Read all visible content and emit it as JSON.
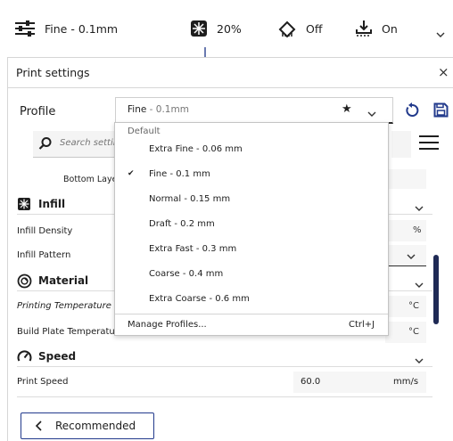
{
  "toolbar": {
    "profile_label": "Fine - 0.1mm",
    "infill_label": "20%",
    "support_label": "Off",
    "adhesion_label": "On"
  },
  "panel": {
    "title": "Print settings",
    "close_label": "×",
    "profile_label": "Profile",
    "selected_profile_name": "Fine",
    "selected_profile_suffix": " - 0.1mm",
    "search_placeholder": "Search settings"
  },
  "settings": {
    "bottom_layers_label": "Bottom Layers",
    "infill": {
      "title": "Infill",
      "density_label": "Infill Density",
      "density_unit": "%",
      "pattern_label": "Infill Pattern"
    },
    "material": {
      "title": "Material",
      "printing_temp_label": "Printing Temperature",
      "printing_temp_unit": "°C",
      "build_plate_temp_label": "Build Plate Temperature",
      "build_plate_temp_unit": "°C"
    },
    "speed": {
      "title": "Speed",
      "print_speed_label": "Print Speed",
      "print_speed_value": "60.0",
      "print_speed_unit": "mm/s"
    }
  },
  "dropdown": {
    "group_label": "Default",
    "items": [
      {
        "label": "Extra Fine - 0.06 mm",
        "checked": false
      },
      {
        "label": "Fine - 0.1 mm",
        "checked": true
      },
      {
        "label": "Normal - 0.15 mm",
        "checked": false
      },
      {
        "label": "Draft - 0.2 mm",
        "checked": false
      },
      {
        "label": "Extra Fast - 0.3 mm",
        "checked": false
      },
      {
        "label": "Coarse - 0.4 mm",
        "checked": false
      },
      {
        "label": "Extra Coarse - 0.6 mm",
        "checked": false
      }
    ],
    "check_glyph": "✔",
    "manage_label": "Manage Profiles...",
    "manage_shortcut": "Ctrl+J"
  },
  "footer": {
    "recommended_label": "Recommended"
  },
  "icons": {
    "star": "★"
  },
  "colors": {
    "accent": "#223a8c",
    "scrollbar": "#1f2a55"
  }
}
